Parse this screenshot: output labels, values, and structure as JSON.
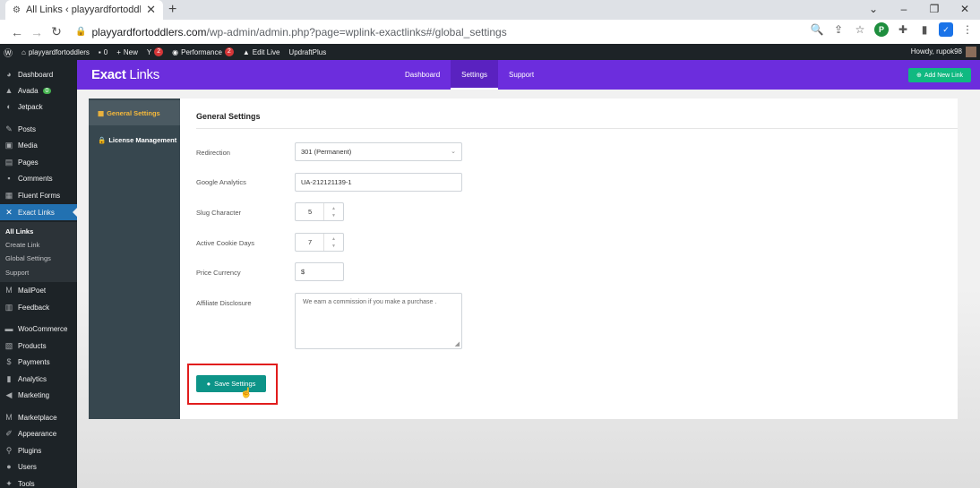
{
  "browser": {
    "tab_title": "All Links ‹ playyardfortoddlers —",
    "url_host": "playyardfortoddlers.com",
    "url_path": "/wp-admin/admin.php?page=wplink-exactlinks#/global_settings"
  },
  "wp_bar": {
    "site": "playyardfortoddlers",
    "comments": "0",
    "new": "New",
    "yoast_count": "2",
    "performance": "Performance",
    "performance_count": "2",
    "edit_live": "Edit Live",
    "updraft": "UpdraftPlus",
    "howdy": "Howdy, rupok98"
  },
  "sidebar": {
    "items": [
      {
        "label": "Dashboard",
        "icon": "dashboard-icon"
      },
      {
        "label": "Avada",
        "badge": "0",
        "icon": "avada-icon"
      },
      {
        "label": "Jetpack",
        "icon": "jetpack-icon"
      },
      {
        "label": "Posts",
        "icon": "pin-icon"
      },
      {
        "label": "Media",
        "icon": "media-icon"
      },
      {
        "label": "Pages",
        "icon": "pages-icon"
      },
      {
        "label": "Comments",
        "icon": "comments-icon"
      },
      {
        "label": "Fluent Forms",
        "icon": "forms-icon"
      },
      {
        "label": "Exact Links",
        "icon": "exactlinks-icon"
      },
      {
        "label": "MailPoet",
        "icon": "mailpoet-icon"
      },
      {
        "label": "Feedback",
        "icon": "feedback-icon"
      },
      {
        "label": "WooCommerce",
        "icon": "woocommerce-icon"
      },
      {
        "label": "Products",
        "icon": "products-icon"
      },
      {
        "label": "Payments",
        "icon": "payments-icon"
      },
      {
        "label": "Analytics",
        "icon": "analytics-icon"
      },
      {
        "label": "Marketing",
        "icon": "marketing-icon"
      },
      {
        "label": "Marketplace",
        "icon": "marketplace-icon"
      },
      {
        "label": "Appearance",
        "icon": "appearance-icon"
      },
      {
        "label": "Plugins",
        "icon": "plugins-icon"
      },
      {
        "label": "Users",
        "icon": "users-icon"
      },
      {
        "label": "Tools",
        "icon": "tools-icon"
      }
    ],
    "submenu": [
      "All Links",
      "Create Link",
      "Global Settings",
      "Support"
    ]
  },
  "plugin": {
    "brand_bold": "Exact",
    "brand_rest": " Links",
    "tabs": [
      "Dashboard",
      "Settings",
      "Support"
    ],
    "add_button": "Add New Link",
    "nav": [
      "General Settings",
      "License Management"
    ],
    "panel_title": "General Settings",
    "fields": {
      "redirection_label": "Redirection",
      "redirection_value": "301 (Permanent)",
      "ga_label": "Google Analytics",
      "ga_value": "UA-212121139-1",
      "slug_label": "Slug Character",
      "slug_value": "5",
      "cookie_label": "Active Cookie Days",
      "cookie_value": "7",
      "currency_label": "Price Currency",
      "currency_value": "$",
      "disclosure_label": "Affiliate Disclosure",
      "disclosure_value": "We earn a commission if you make a purchase ."
    },
    "save_button": "Save Settings"
  },
  "colors": {
    "plugin_header": "#6c2ddd",
    "save_button": "#0d9488",
    "highlight": "#e11d1d",
    "wp_admin_dark": "#1d2327",
    "active_menu": "#2271b1"
  }
}
